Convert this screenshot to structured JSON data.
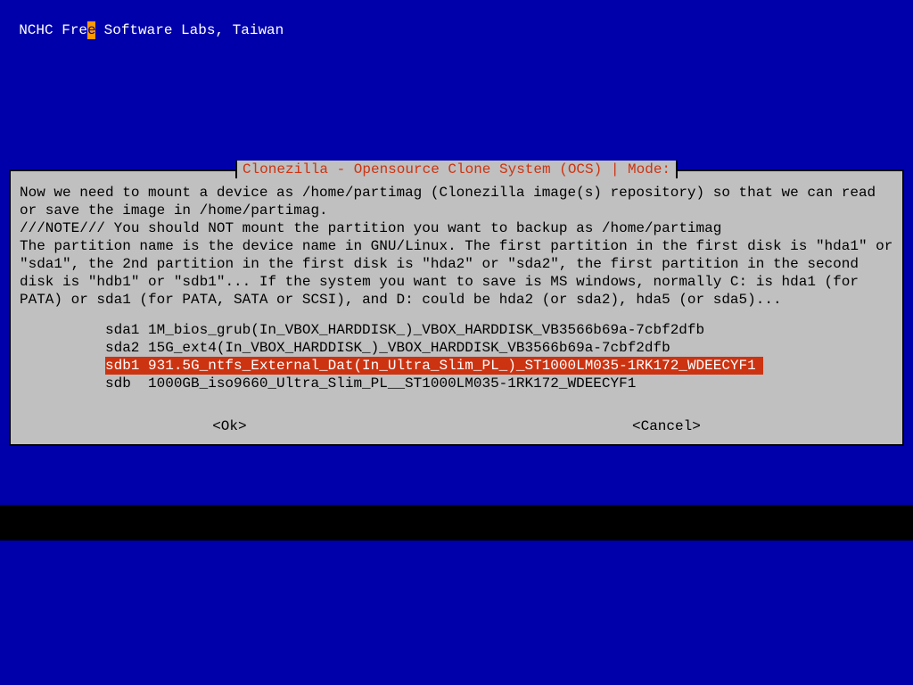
{
  "header": {
    "pre": "NCHC Fre",
    "cursor": "e",
    "post": " Software Labs, Taiwan"
  },
  "dialog": {
    "title": "Clonezilla - Opensource Clone System (OCS) | Mode:",
    "body": "Now we need to mount a device as /home/partimag (Clonezilla image(s) repository) so that we can read or save the image in /home/partimag.\n///NOTE/// You should NOT mount the partition you want to backup as /home/partimag\nThe partition name is the device name in GNU/Linux. The first partition in the first disk is \"hda1\" or \"sda1\", the 2nd partition in the first disk is \"hda2\" or \"sda2\", the first partition in the second disk is \"hdb1\" or \"sdb1\"... If the system you want to save is MS windows, normally C: is hda1 (for PATA) or sda1 (for PATA, SATA or SCSI), and D: could be hda2 (or sda2), hda5 (or sda5)...",
    "options": [
      {
        "text": "sda1 1M_bios_grub(In_VBOX_HARDDISK_)_VBOX_HARDDISK_VB3566b69a-7cbf2dfb",
        "selected": false
      },
      {
        "text": "sda2 15G_ext4(In_VBOX_HARDDISK_)_VBOX_HARDDISK_VB3566b69a-7cbf2dfb",
        "selected": false
      },
      {
        "text": "sdb1 931.5G_ntfs_External_Dat(In_Ultra_Slim_PL_)_ST1000LM035-1RK172_WDEECYF1",
        "selected": true
      },
      {
        "text": "sdb  1000GB_iso9660_Ultra_Slim_PL__ST1000LM035-1RK172_WDEECYF1",
        "selected": false
      }
    ],
    "buttons": {
      "ok": "<Ok>",
      "cancel": "<Cancel>"
    }
  }
}
